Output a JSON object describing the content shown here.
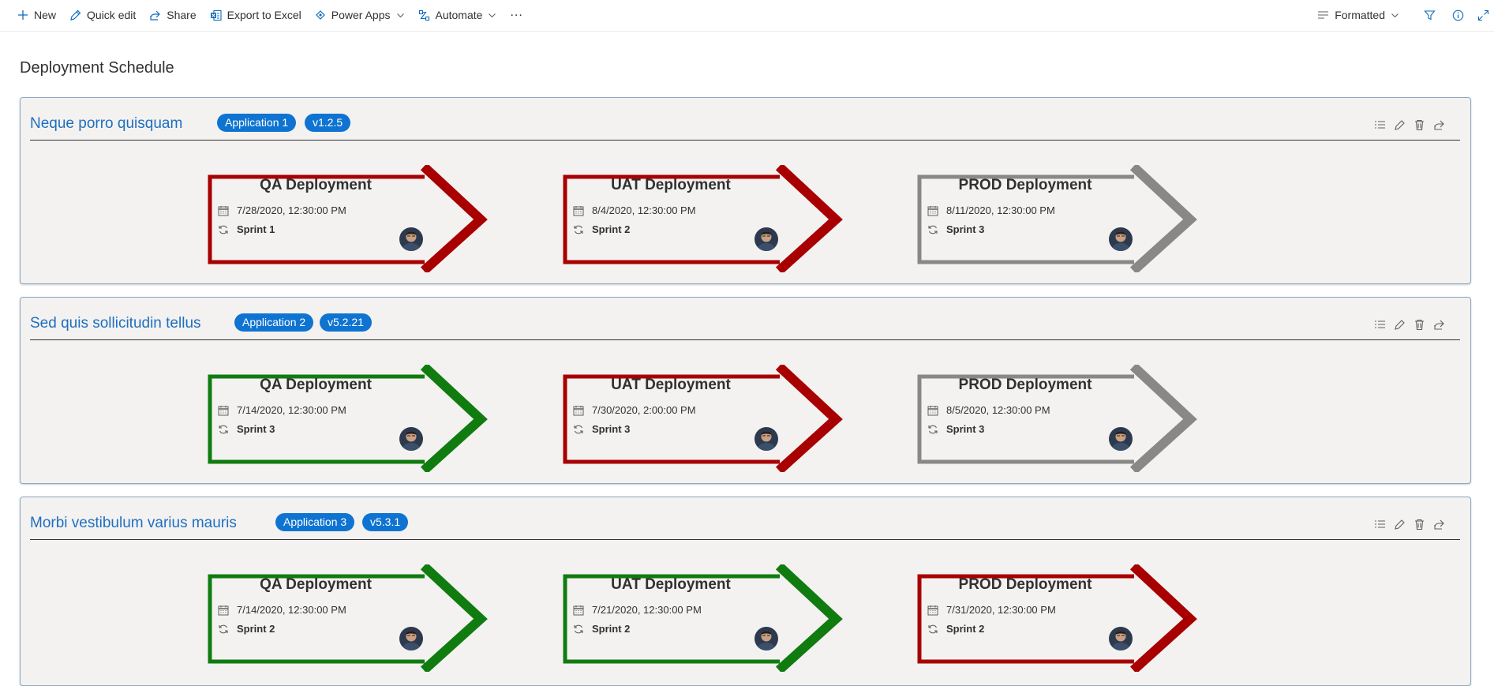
{
  "toolbar": {
    "new_label": "New",
    "quick_edit_label": "Quick edit",
    "share_label": "Share",
    "export_label": "Export to Excel",
    "power_apps_label": "Power Apps",
    "automate_label": "Automate",
    "more_label": "...",
    "view_label": "Formatted"
  },
  "page": {
    "title": "Deployment Schedule"
  },
  "colors": {
    "red": "#a80000",
    "green": "#107c10",
    "gray": "#8a8886",
    "pill": "#0f74d1",
    "link": "#1f6fbf"
  },
  "cards": [
    {
      "title": "Neque porro quisquam",
      "app": "Application 1",
      "version": "v1.2.5",
      "stages": [
        {
          "title": "QA Deployment",
          "date": "7/28/2020, 12:30:00 PM",
          "sprint": "Sprint 1",
          "status": "red"
        },
        {
          "title": "UAT Deployment",
          "date": "8/4/2020, 12:30:00 PM",
          "sprint": "Sprint 2",
          "status": "red"
        },
        {
          "title": "PROD Deployment",
          "date": "8/11/2020, 12:30:00 PM",
          "sprint": "Sprint 3",
          "status": "gray"
        }
      ]
    },
    {
      "title": "Sed quis sollicitudin tellus",
      "app": "Application 2",
      "version": "v5.2.21",
      "stages": [
        {
          "title": "QA Deployment",
          "date": "7/14/2020, 12:30:00 PM",
          "sprint": "Sprint 3",
          "status": "green"
        },
        {
          "title": "UAT Deployment",
          "date": "7/30/2020, 2:00:00 PM",
          "sprint": "Sprint 3",
          "status": "red"
        },
        {
          "title": "PROD Deployment",
          "date": "8/5/2020, 12:30:00 PM",
          "sprint": "Sprint 3",
          "status": "gray"
        }
      ]
    },
    {
      "title": "Morbi vestibulum varius mauris",
      "app": "Application 3",
      "version": "v5.3.1",
      "stages": [
        {
          "title": "QA Deployment",
          "date": "7/14/2020, 12:30:00 PM",
          "sprint": "Sprint 2",
          "status": "green"
        },
        {
          "title": "UAT Deployment",
          "date": "7/21/2020, 12:30:00 PM",
          "sprint": "Sprint 2",
          "status": "green"
        },
        {
          "title": "PROD Deployment",
          "date": "7/31/2020, 12:30:00 PM",
          "sprint": "Sprint 2",
          "status": "red"
        }
      ]
    }
  ]
}
